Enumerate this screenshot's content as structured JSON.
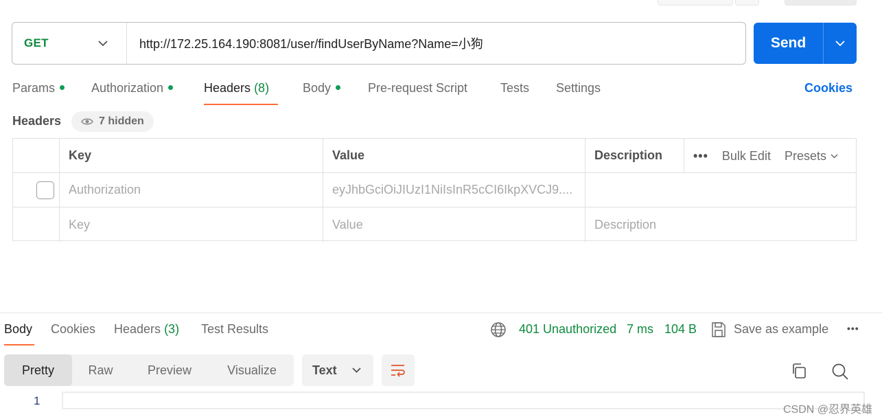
{
  "request": {
    "method": "GET",
    "url": "http://172.25.164.190:8081/user/findUserByName?Name=小狗",
    "send_label": "Send"
  },
  "request_tabs": {
    "params": "Params",
    "authorization": "Authorization",
    "headers": "Headers",
    "headers_count": "(8)",
    "body": "Body",
    "pre_request_script": "Pre-request Script",
    "tests": "Tests",
    "settings": "Settings",
    "cookies": "Cookies"
  },
  "headers_section": {
    "title": "Headers",
    "hidden_label": "7 hidden",
    "columns": {
      "key": "Key",
      "value": "Value",
      "description": "Description"
    },
    "bulk_edit": "Bulk Edit",
    "presets": "Presets",
    "rows": [
      {
        "key": "Authorization",
        "value": "eyJhbGciOiJIUzI1NiIsInR5cCI6IkpXVCJ9....",
        "description": ""
      }
    ],
    "placeholder": {
      "key": "Key",
      "value": "Value",
      "description": "Description"
    }
  },
  "response": {
    "tabs": {
      "body": "Body",
      "cookies": "Cookies",
      "headers": "Headers",
      "headers_count": "(3)",
      "test_results": "Test Results"
    },
    "status": "401 Unauthorized",
    "time": "7 ms",
    "size": "104 B",
    "save_as_example": "Save as example",
    "formats": [
      "Pretty",
      "Raw",
      "Preview",
      "Visualize"
    ],
    "language": "Text",
    "line_number": "1"
  },
  "watermark": "CSDN @忍界英雄",
  "colors": {
    "accent": "#ff6c37",
    "send": "#0b6ee6",
    "success": "#0f8a3f"
  }
}
